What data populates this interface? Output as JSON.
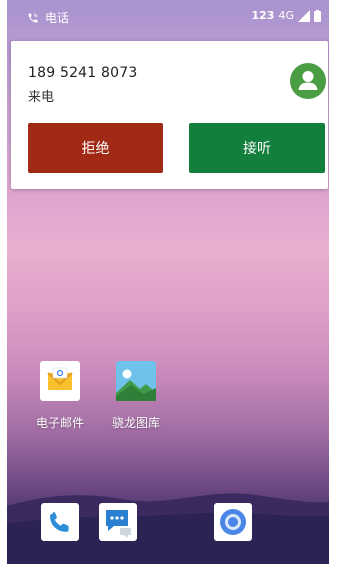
{
  "status_bar": {
    "left_label": "电话",
    "network_label": "4G",
    "ime_label": "123"
  },
  "incoming_call": {
    "number": "189 5241 8073",
    "state": "来电",
    "decline_label": "拒绝",
    "answer_label": "接听",
    "decline_color": "#a02a16",
    "answer_color": "#137f3c",
    "avatar_color": "#4b9d43"
  },
  "home": {
    "apps": [
      {
        "label": "电子邮件",
        "icon": "email-icon"
      },
      {
        "label": "骁龙图库",
        "icon": "gallery-icon"
      }
    ],
    "dock": [
      {
        "icon": "phone-icon"
      },
      {
        "icon": "messages-icon"
      },
      {
        "icon": "browser-icon"
      }
    ]
  }
}
